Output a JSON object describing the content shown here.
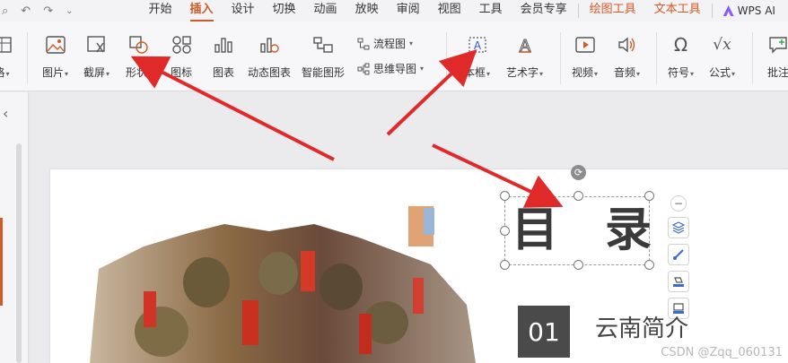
{
  "menubar": {
    "tabs": [
      {
        "label": "开始"
      },
      {
        "label": "插入"
      },
      {
        "label": "设计"
      },
      {
        "label": "切换"
      },
      {
        "label": "动画"
      },
      {
        "label": "放映"
      },
      {
        "label": "审阅"
      },
      {
        "label": "视图"
      },
      {
        "label": "工具"
      },
      {
        "label": "会员专享"
      }
    ],
    "context_tabs": [
      {
        "label": "绘图工具"
      },
      {
        "label": "文本工具"
      }
    ],
    "ai_label": "WPS AI",
    "active_color": "#d05b26"
  },
  "ribbon": {
    "items": [
      {
        "label": "格"
      },
      {
        "label": "图片"
      },
      {
        "label": "截屏"
      },
      {
        "label": "形状"
      },
      {
        "label": "图标"
      },
      {
        "label": "图表"
      },
      {
        "label": "动态图表"
      },
      {
        "label": "智能图形"
      },
      {
        "label": "本框"
      },
      {
        "label": "艺术字"
      },
      {
        "label": "视频"
      },
      {
        "label": "音频"
      },
      {
        "label": "符号"
      },
      {
        "label": "公式"
      },
      {
        "label": "批注"
      }
    ],
    "flowchart_label": "流程图",
    "mindmap_label": "思维导图"
  },
  "slide": {
    "title": "目录",
    "item_number": "01",
    "item_text": "云南简介"
  },
  "watermark": "CSDN @Zqq_060131",
  "colors": {
    "accent": "#d05b26",
    "annotation_arrow": "#e02a2a",
    "badge": "#4a4a4a"
  }
}
